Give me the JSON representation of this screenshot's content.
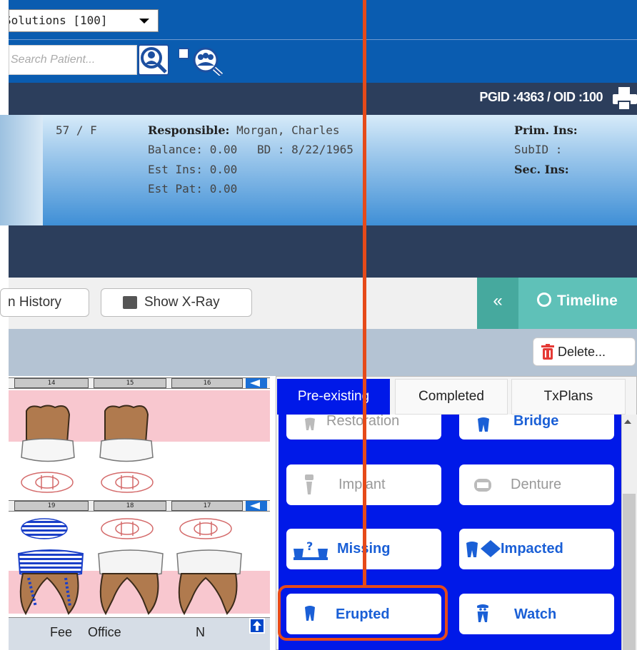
{
  "header": {
    "practice_select": "Solutions [100]",
    "search_placeholder": "Search Patient...",
    "pgid": "PGID :4363 / OID :100"
  },
  "patient": {
    "age_sex": "57 / F",
    "responsible_label": "Responsible:",
    "responsible_name": "Morgan, Charles",
    "balance": "Balance: 0.00",
    "bd": "BD : 8/22/1965",
    "est_ins": "Est Ins:  0.00",
    "est_pat": "Est Pat: 0.00",
    "prim_ins": "Prim. Ins:",
    "subid": "SubID :",
    "sec_ins": "Sec. Ins:"
  },
  "toolbar": {
    "history_label": "n History",
    "xray_label": "Show X-Ray",
    "chevron": "«",
    "timeline_label": "Timeline",
    "delete_label": "Delete..."
  },
  "chart": {
    "upper_numbers": [
      "14",
      "15",
      "16"
    ],
    "lower_numbers": [
      "19",
      "18",
      "17"
    ]
  },
  "grid": {
    "fee": "Fee",
    "office": "Office",
    "n": "N"
  },
  "tabs": [
    "Pre-existing",
    "Completed",
    "TxPlans"
  ],
  "conditions": {
    "restoration": "Restoration",
    "bridge": "Bridge",
    "implant": "Implant",
    "denture": "Denture",
    "missing": "Missing",
    "impacted": "Impacted",
    "erupted": "Erupted",
    "watch": "Watch"
  },
  "colors": {
    "header_blue": "#0a5cb0",
    "navy": "#2c3e5c",
    "teal": "#5fc1b8",
    "panel_blue": "#0019e8",
    "callout": "#e64a19"
  }
}
